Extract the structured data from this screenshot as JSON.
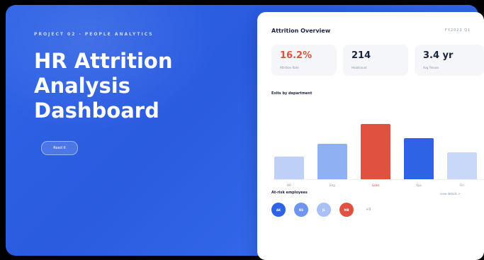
{
  "hero": {
    "eyebrow": "PROJECT 02 · PEOPLE ANALYTICS",
    "title": "HR Attrition Analysis Dashboard",
    "cta_label": "Read it"
  },
  "dashboard": {
    "title": "Attrition Overview",
    "period": "FY2023 Q1",
    "kpis": [
      {
        "value": "16.2%",
        "label": "Attrition Rate",
        "color": "#e0523f"
      },
      {
        "value": "214",
        "label": "Headcount",
        "color": "#1b2340"
      },
      {
        "value": "3.4 yr",
        "label": "Avg Tenure",
        "color": "#1b2340"
      }
    ],
    "chart_title": "Exits by department",
    "chart_data": {
      "type": "bar",
      "categories": [
        "HR",
        "Eng",
        "Sales",
        "Ops",
        "Fin"
      ],
      "values": [
        32,
        50,
        78,
        58,
        38
      ],
      "colors": [
        "#bfd0f7",
        "#8fb0f2",
        "#e0523f",
        "#2f63e6",
        "#c9d7f8"
      ],
      "ylim": [
        0,
        80
      ]
    },
    "risk_title": "At-risk employees",
    "risk_link": "view details >",
    "avatars": [
      {
        "initials": "AK",
        "color": "#2f63e6"
      },
      {
        "initials": "RS",
        "color": "#6f95f0"
      },
      {
        "initials": "JL",
        "color": "#a9c0f5"
      },
      {
        "initials": "MB",
        "color": "#e0523f"
      }
    ],
    "more": "+9"
  }
}
